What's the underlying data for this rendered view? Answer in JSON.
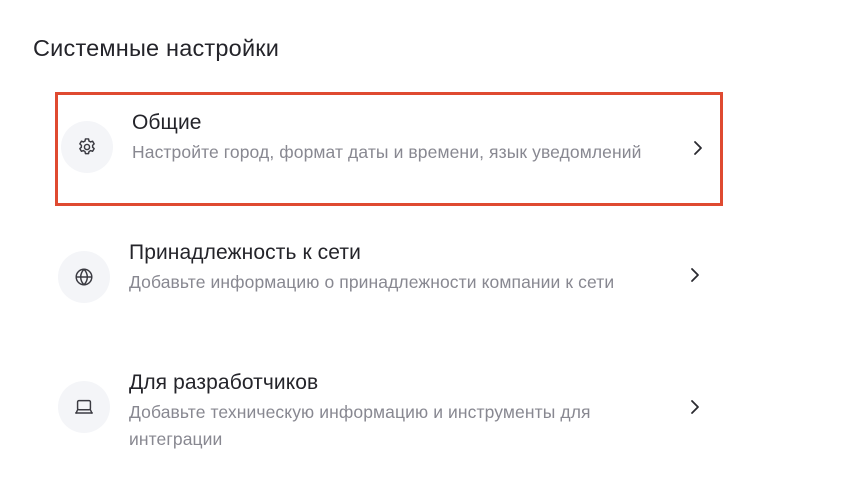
{
  "header": {
    "title": "Системные настройки"
  },
  "settings": {
    "items": [
      {
        "title": "Общие",
        "description": "Настройте город, формат даты и времени, язык уведомлений",
        "icon": "gear-icon",
        "selected": true
      },
      {
        "title": "Принадлежность к сети",
        "description": "Добавьте информацию о принадлежности компании к сети",
        "icon": "globe-icon",
        "selected": false
      },
      {
        "title": "Для разработчиков",
        "description": "Добавьте техническую информацию и инструменты для интеграции",
        "icon": "laptop-icon",
        "selected": false
      }
    ]
  },
  "colors": {
    "highlight_border": "#df4a31",
    "title_text": "#24242a",
    "description_text": "#888891",
    "icon_background": "#f4f5f8"
  }
}
